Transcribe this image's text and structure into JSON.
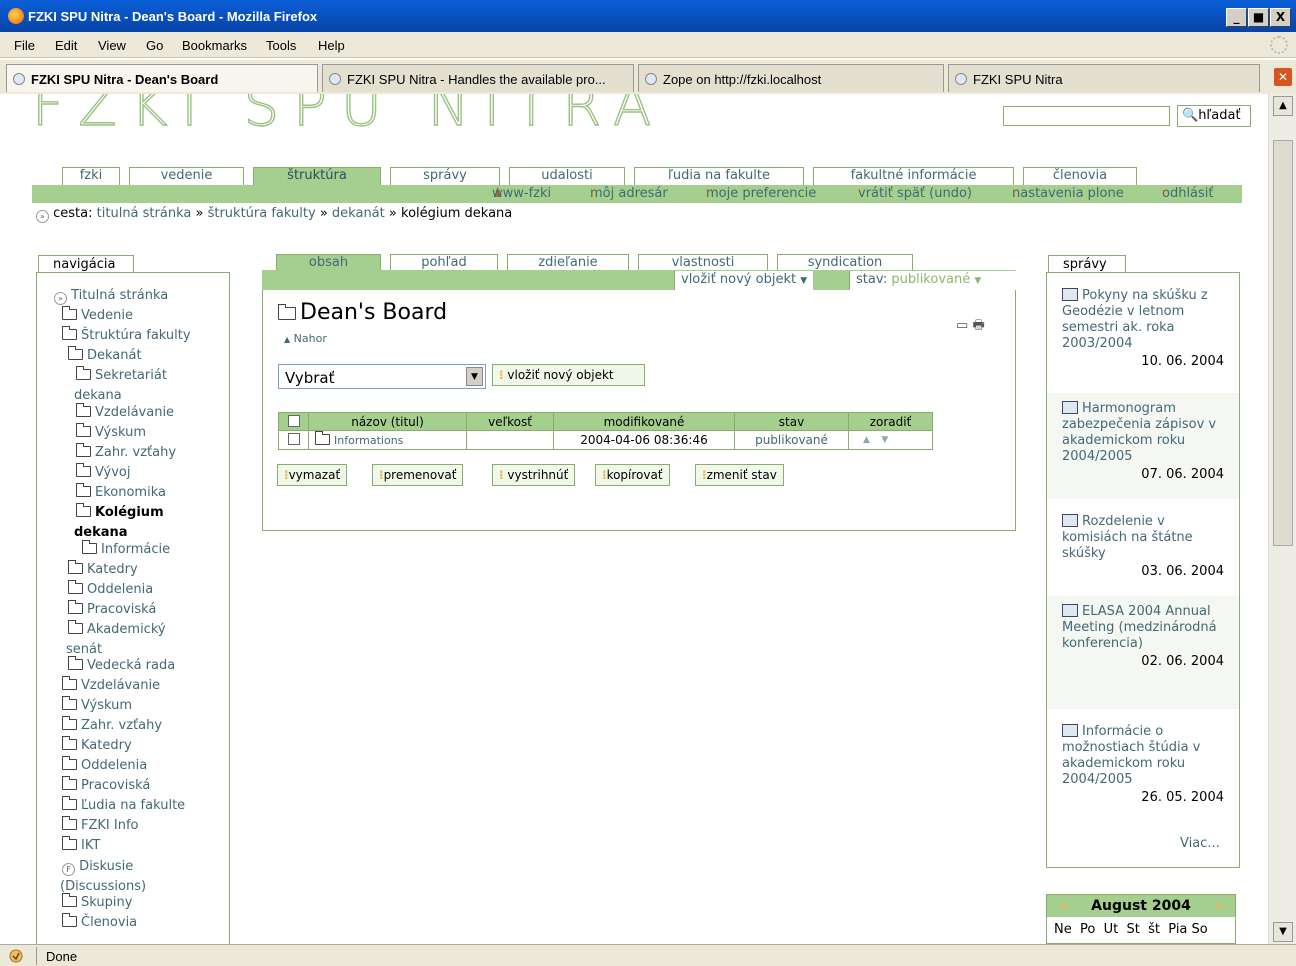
{
  "window": {
    "title": "FZKI SPU Nitra - Dean's Board - Mozilla Firefox",
    "min": "_",
    "max": "■",
    "close": "X"
  },
  "menu": [
    "File",
    "Edit",
    "View",
    "Go",
    "Bookmarks",
    "Tools",
    "Help"
  ],
  "tabs": [
    {
      "label": "FZKI SPU Nitra - Dean's Board"
    },
    {
      "label": "FZKI SPU Nitra - Handles the available pro..."
    },
    {
      "label": "Zope on http://fzki.localhost"
    },
    {
      "label": "FZKI SPU Nitra"
    }
  ],
  "site": {
    "logo": "FZKI SPU NITRA",
    "search_button": "hľadať",
    "search_value": "",
    "main_tabs": [
      "fzki",
      "vedenie",
      "štruktúra",
      "správy",
      "udalosti",
      "ľudia na fakulte",
      "fakultné informácie",
      "členovia"
    ],
    "user": "www-fzki",
    "user_actions": [
      "môj adresár",
      "moje preferencie",
      "vrátiť späť (undo)",
      "nastavenia plone",
      "odhlásiť"
    ],
    "breadcrumb": {
      "label": "cesta:",
      "items": [
        "titulná stránka",
        "štruktúra fakulty",
        "dekanát"
      ],
      "sep": "»",
      "current": "kolégium dekana"
    }
  },
  "nav": {
    "title": "navigácia",
    "items": [
      {
        "label": "Titulná stránka",
        "icon": "home-icon"
      },
      {
        "label": "Vedenie",
        "icon": "folder-icon"
      },
      {
        "label": "Štruktúra fakulty",
        "icon": "folder-icon"
      },
      {
        "label": "Dekanát",
        "icon": "folder-icon"
      },
      {
        "label": "Sekretariát",
        "cont": "dekana",
        "icon": "folder-icon"
      },
      {
        "label": "Vzdelávanie",
        "icon": "folder-icon"
      },
      {
        "label": "Výskum",
        "icon": "folder-icon"
      },
      {
        "label": "Zahr. vzťahy",
        "icon": "folder-icon"
      },
      {
        "label": "Vývoj",
        "icon": "folder-icon"
      },
      {
        "label": "Ekonomika",
        "icon": "folder-icon"
      },
      {
        "label": "Kolégium",
        "cont": "dekana",
        "icon": "folder-icon",
        "current": true
      },
      {
        "label": "Informácie",
        "icon": "folder-icon"
      },
      {
        "label": "Katedry",
        "icon": "folder-icon"
      },
      {
        "label": "Oddelenia",
        "icon": "folder-icon"
      },
      {
        "label": "Pracoviská",
        "icon": "folder-icon"
      },
      {
        "label": "Akademický",
        "cont": "senát",
        "icon": "folder-icon"
      },
      {
        "label": "Vedecká rada",
        "icon": "folder-icon"
      },
      {
        "label": "Vzdelávanie",
        "icon": "folder-icon"
      },
      {
        "label": "Výskum",
        "icon": "folder-icon"
      },
      {
        "label": "Zahr. vzťahy",
        "icon": "folder-icon"
      },
      {
        "label": "Katedry",
        "icon": "folder-icon"
      },
      {
        "label": "Oddelenia",
        "icon": "folder-icon"
      },
      {
        "label": "Pracoviská",
        "icon": "folder-icon"
      },
      {
        "label": "Ľudia na fakulte",
        "icon": "folder-icon"
      },
      {
        "label": "FZKI Info",
        "icon": "folder-icon"
      },
      {
        "label": "IKT",
        "icon": "folder-icon"
      },
      {
        "label": "Diskusie",
        "cont": "(Discussions)",
        "icon": "forum-icon"
      },
      {
        "label": "Skupiny",
        "icon": "folder-icon"
      },
      {
        "label": "Členovia",
        "icon": "folder-icon"
      }
    ]
  },
  "content": {
    "tabs": [
      "obsah",
      "pohľad",
      "zdieľanie",
      "vlastnosti",
      "syndication"
    ],
    "add_menu": "vložiť nový objekt",
    "state_label": "stav:",
    "state_value": "publikované",
    "title": "Dean's Board",
    "up_link": "Nahor",
    "select_value": "Vybrať",
    "add_button": "vložiť nový objekt",
    "table": {
      "headers": [
        "názov (titul)",
        "veľkosť",
        "modifikované",
        "stav",
        "zoradiť"
      ],
      "rows": [
        {
          "name": "Informations",
          "size": "",
          "modified": "2004-04-06 08:36:46",
          "state": "publikované",
          "order_up": "▲",
          "order_down": "▼"
        }
      ]
    },
    "actions": [
      "vymazať",
      "premenovať",
      "vystrihnúť",
      "kopírovať",
      "zmeniť stav"
    ]
  },
  "news": {
    "title": "správy",
    "items": [
      {
        "title": "Pokyny na skúšku z Geodézie v letnom semestri ak. roka 2003/2004",
        "date": "10. 06. 2004"
      },
      {
        "title": "Harmonogram zabezpečenia zápisov v akademickom roku 2004/2005",
        "date": "07. 06. 2004"
      },
      {
        "title": "Rozdelenie v komisiách na štátne skúšky",
        "date": "03. 06. 2004"
      },
      {
        "title": "ELASA 2004 Annual Meeting (medzinárodná konferencia)",
        "date": "02. 06. 2004"
      },
      {
        "title": "Informácie o možnostiach štúdia v akademickom roku 2004/2005",
        "date": "26. 05. 2004"
      }
    ],
    "more": "Viac..."
  },
  "calendar": {
    "prev": "«",
    "month": "August 2004",
    "next": "»",
    "days": [
      "Ne",
      "Po",
      "Ut",
      "St",
      "št",
      "Pia",
      "So"
    ]
  },
  "status": "Done"
}
